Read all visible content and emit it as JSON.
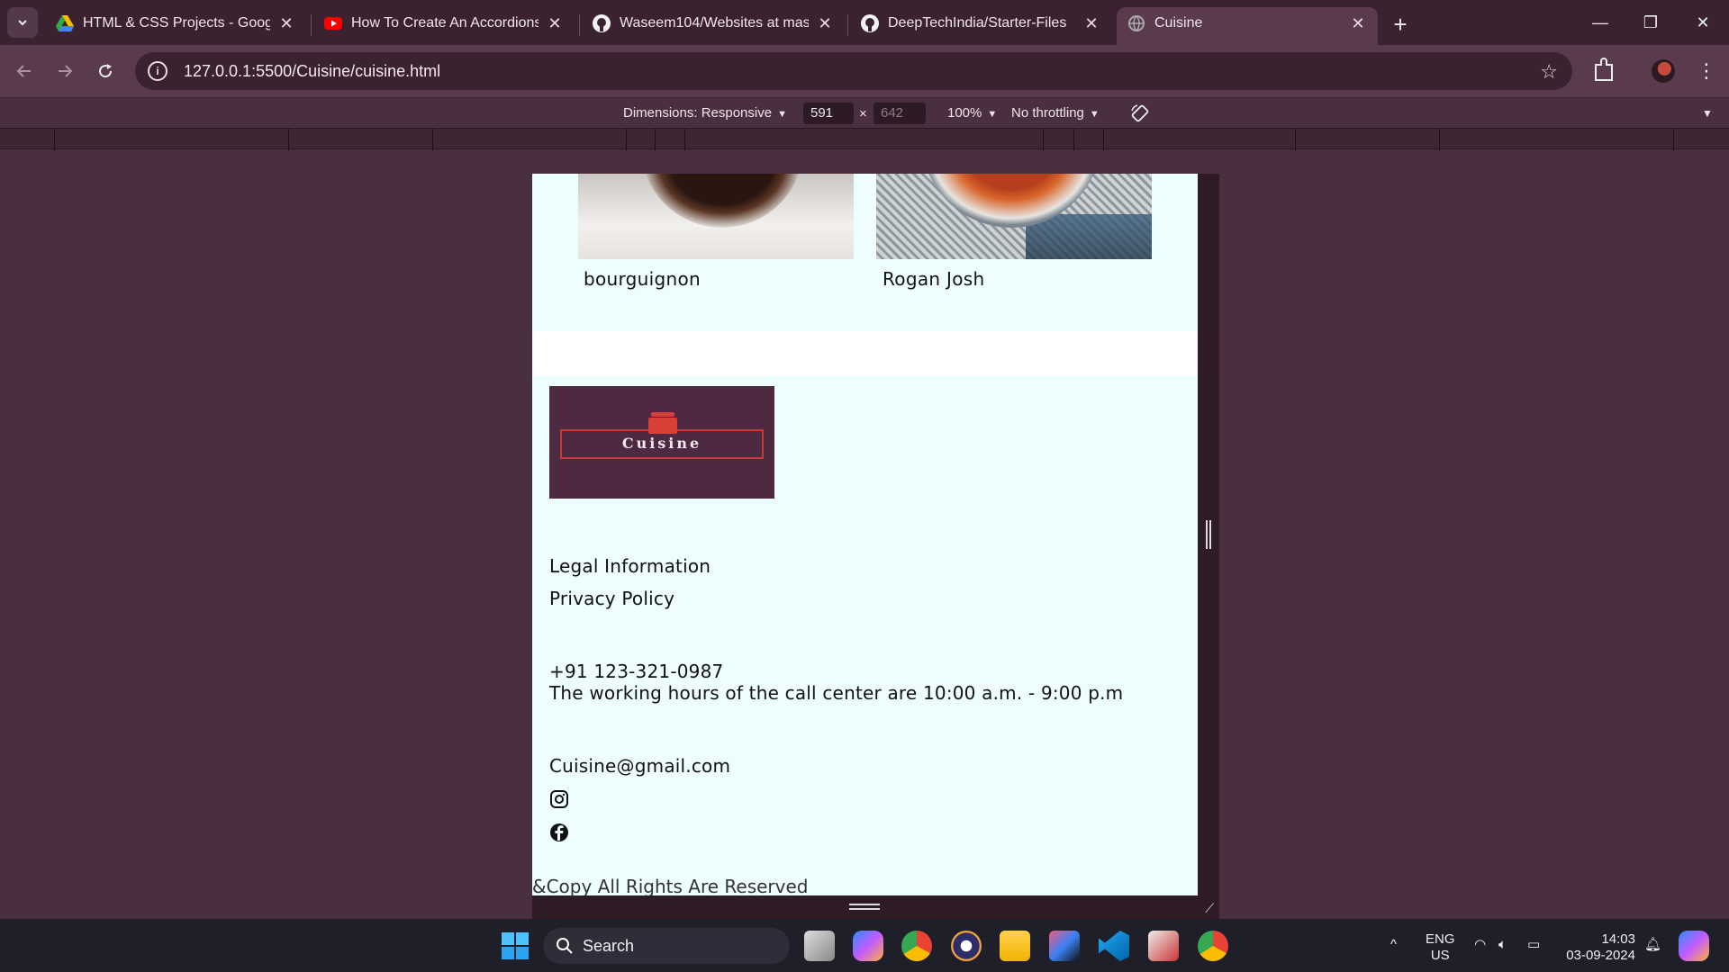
{
  "browser": {
    "tabs": [
      {
        "title": "HTML & CSS Projects - Google",
        "favicon": "google-drive-icon",
        "active": false
      },
      {
        "title": "How To Create An Accordions In",
        "favicon": "youtube-icon",
        "active": false
      },
      {
        "title": "Waseem104/Websites at master",
        "favicon": "github-icon",
        "active": false
      },
      {
        "title": "DeepTechIndia/Starter-Files",
        "favicon": "github-icon",
        "active": false
      },
      {
        "title": "Cuisine",
        "favicon": "globe-icon",
        "active": true
      }
    ],
    "url": "127.0.0.1:5500/Cuisine/cuisine.html"
  },
  "devtools": {
    "dimensions_label": "Dimensions: Responsive",
    "width_value": "591",
    "times": "×",
    "height_value": "642",
    "zoom": "100%",
    "throttling": "No throttling"
  },
  "page": {
    "dishes": [
      {
        "name": "bourguignon"
      },
      {
        "name": "Rogan Josh"
      }
    ],
    "logo_text": "Cuisine",
    "footer_links": [
      "Legal Information",
      "Privacy Policy"
    ],
    "phone": "+91 123-321-0987",
    "hours": "The working hours of the call center are 10:00 a.m. - 9:00 p.m",
    "email": "Cuisine@gmail.com",
    "social": [
      "instagram-icon",
      "facebook-icon"
    ],
    "copyright": "&Copy All Rights Are Reserved"
  },
  "taskbar": {
    "search_label": "Search",
    "lang_top": "ENG",
    "lang_bottom": "US",
    "time": "14:03",
    "date": "03-09-2024"
  }
}
